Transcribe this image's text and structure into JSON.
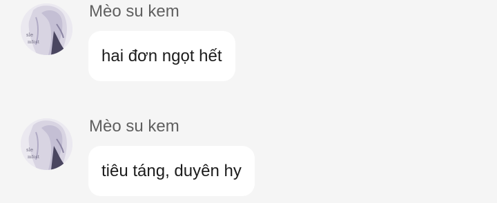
{
  "messages": [
    {
      "sender": "Mèo su kem",
      "text": "hai đơn ngọt hết",
      "avatar_icon": "anime-silver-hair-avatar"
    },
    {
      "sender": "Mèo su kem",
      "text": "tiêu táng, duyên hy",
      "avatar_icon": "anime-silver-hair-avatar"
    }
  ],
  "colors": {
    "background": "#f5f5f5",
    "bubble": "#ffffff",
    "sender_text": "#5f5f5f",
    "message_text": "#1c1c1c"
  }
}
